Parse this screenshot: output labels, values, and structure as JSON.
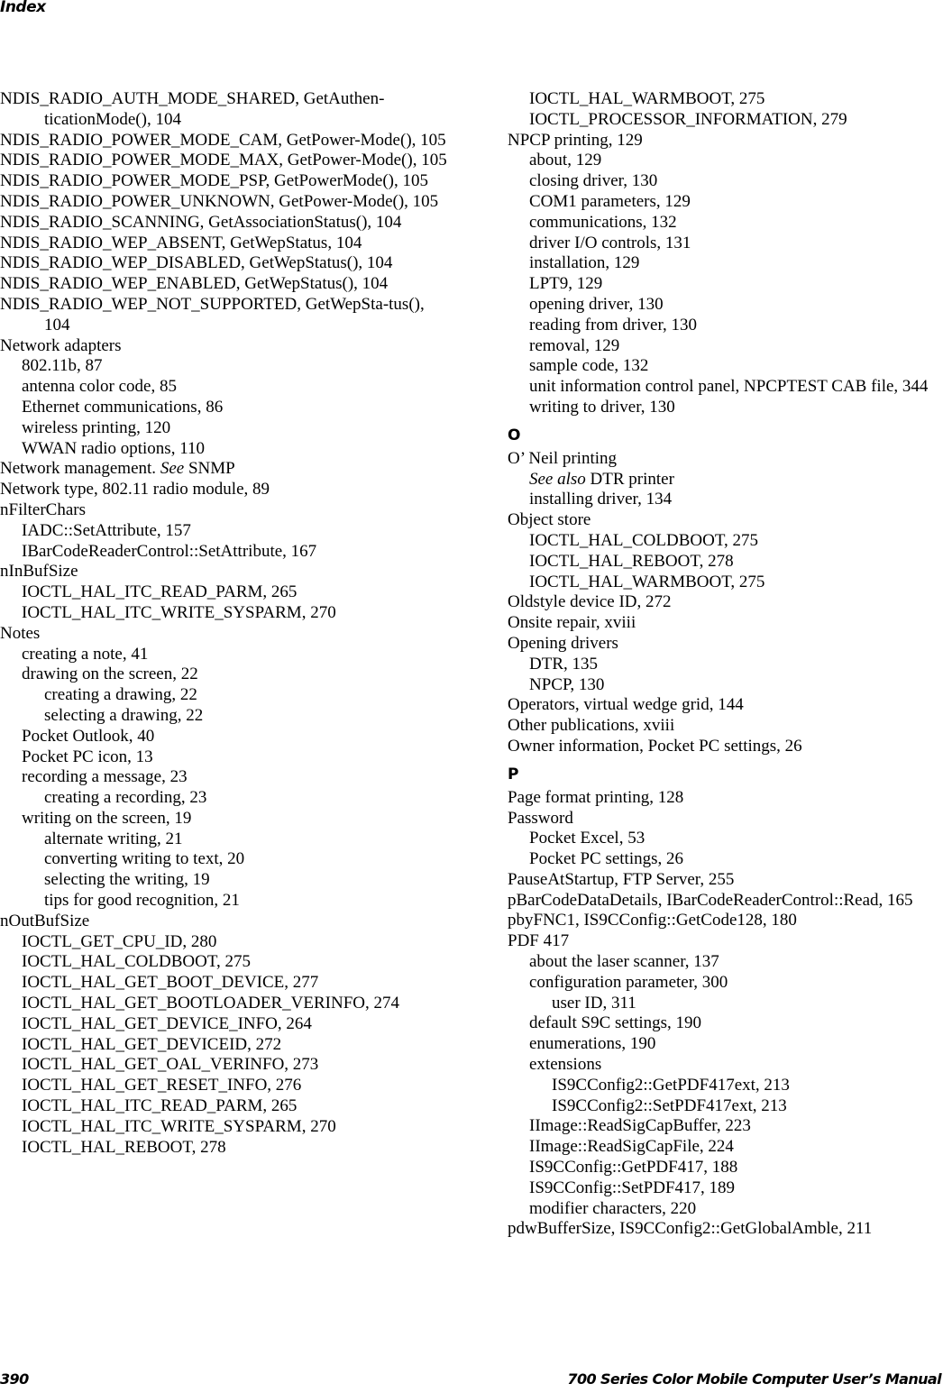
{
  "header": {
    "running_head": "Index"
  },
  "footer": {
    "page_number": "390",
    "manual_title": "700 Series Color Mobile Computer User’s Manual"
  },
  "left_column": [
    {
      "level": 0,
      "text": "NDIS_RADIO_AUTH_MODE_SHARED, GetAuthen-ticationMode(), 104"
    },
    {
      "level": 0,
      "text": "NDIS_RADIO_POWER_MODE_CAM, GetPower-Mode(), 105"
    },
    {
      "level": 0,
      "text": "NDIS_RADIO_POWER_MODE_MAX, GetPower-Mode(), 105"
    },
    {
      "level": 0,
      "text": "NDIS_RADIO_POWER_MODE_PSP, GetPowerMode(), 105"
    },
    {
      "level": 0,
      "text": "NDIS_RADIO_POWER_UNKNOWN, GetPower-Mode(), 105"
    },
    {
      "level": 0,
      "text": "NDIS_RADIO_SCANNING, GetAssociationStatus(), 104"
    },
    {
      "level": 0,
      "text": "NDIS_RADIO_WEP_ABSENT, GetWepStatus, 104"
    },
    {
      "level": 0,
      "text": "NDIS_RADIO_WEP_DISABLED, GetWepStatus(), 104"
    },
    {
      "level": 0,
      "text": "NDIS_RADIO_WEP_ENABLED, GetWepStatus(), 104"
    },
    {
      "level": 0,
      "text": "NDIS_RADIO_WEP_NOT_SUPPORTED, GetWepSta-tus(), 104"
    },
    {
      "level": 0,
      "text": "Network adapters"
    },
    {
      "level": 1,
      "text": "802.11b, 87"
    },
    {
      "level": 1,
      "text": "antenna color code, 85"
    },
    {
      "level": 1,
      "text": "Ethernet communications, 86"
    },
    {
      "level": 1,
      "text": "wireless printing, 120"
    },
    {
      "level": 1,
      "text": "WWAN radio options, 110"
    },
    {
      "level": 0,
      "text": "Network management. ",
      "see": "See",
      "after": " SNMP"
    },
    {
      "level": 0,
      "text": "Network type, 802.11 radio module, 89"
    },
    {
      "level": 0,
      "text": "nFilterChars"
    },
    {
      "level": 1,
      "text": "IADC::SetAttribute, 157"
    },
    {
      "level": 1,
      "text": "IBarCodeReaderControl::SetAttribute, 167"
    },
    {
      "level": 0,
      "text": "nInBufSize"
    },
    {
      "level": 1,
      "text": "IOCTL_HAL_ITC_READ_PARM, 265"
    },
    {
      "level": 1,
      "text": "IOCTL_HAL_ITC_WRITE_SYSPARM, 270"
    },
    {
      "level": 0,
      "text": "Notes"
    },
    {
      "level": 1,
      "text": "creating a note, 41"
    },
    {
      "level": 1,
      "text": "drawing on the screen, 22"
    },
    {
      "level": 2,
      "text": "creating a drawing, 22"
    },
    {
      "level": 2,
      "text": "selecting a drawing, 22"
    },
    {
      "level": 1,
      "text": "Pocket Outlook, 40"
    },
    {
      "level": 1,
      "text": "Pocket PC icon, 13"
    },
    {
      "level": 1,
      "text": "recording a message, 23"
    },
    {
      "level": 2,
      "text": "creating a recording, 23"
    },
    {
      "level": 1,
      "text": "writing on the screen, 19"
    },
    {
      "level": 2,
      "text": "alternate writing, 21"
    },
    {
      "level": 2,
      "text": "converting writing to text, 20"
    },
    {
      "level": 2,
      "text": "selecting the writing, 19"
    },
    {
      "level": 2,
      "text": "tips for good recognition, 21"
    },
    {
      "level": 0,
      "text": "nOutBufSize"
    },
    {
      "level": 1,
      "text": "IOCTL_GET_CPU_ID, 280"
    },
    {
      "level": 1,
      "text": "IOCTL_HAL_COLDBOOT, 275"
    },
    {
      "level": 1,
      "text": "IOCTL_HAL_GET_BOOT_DEVICE, 277"
    },
    {
      "level": 1,
      "text": "IOCTL_HAL_GET_BOOTLOADER_VERINFO, 274"
    },
    {
      "level": 1,
      "text": "IOCTL_HAL_GET_DEVICE_INFO, 264"
    },
    {
      "level": 1,
      "text": "IOCTL_HAL_GET_DEVICEID, 272"
    },
    {
      "level": 1,
      "text": "IOCTL_HAL_GET_OAL_VERINFO, 273"
    },
    {
      "level": 1,
      "text": "IOCTL_HAL_GET_RESET_INFO, 276"
    },
    {
      "level": 1,
      "text": "IOCTL_HAL_ITC_READ_PARM, 265"
    },
    {
      "level": 1,
      "text": "IOCTL_HAL_ITC_WRITE_SYSPARM, 270"
    },
    {
      "level": 1,
      "text": "IOCTL_HAL_REBOOT, 278"
    }
  ],
  "right_column": [
    {
      "level": 1,
      "text": "IOCTL_HAL_WARMBOOT, 275"
    },
    {
      "level": 1,
      "text": "IOCTL_PROCESSOR_INFORMATION, 279"
    },
    {
      "level": 0,
      "text": "NPCP printing, 129"
    },
    {
      "level": 1,
      "text": "about, 129"
    },
    {
      "level": 1,
      "text": "closing driver, 130"
    },
    {
      "level": 1,
      "text": "COM1 parameters, 129"
    },
    {
      "level": 1,
      "text": "communications, 132"
    },
    {
      "level": 1,
      "text": "driver I/O controls, 131"
    },
    {
      "level": 1,
      "text": "installation, 129"
    },
    {
      "level": 1,
      "text": "LPT9, 129"
    },
    {
      "level": 1,
      "text": "opening driver, 130"
    },
    {
      "level": 1,
      "text": "reading from driver, 130"
    },
    {
      "level": 1,
      "text": "removal, 129"
    },
    {
      "level": 1,
      "text": "sample code, 132"
    },
    {
      "level": 1,
      "text": "unit information control panel, NPCPTEST CAB file, 344"
    },
    {
      "level": 1,
      "text": "writing to driver, 130"
    },
    {
      "letter": "O"
    },
    {
      "level": 0,
      "text": "O’ Neil printing"
    },
    {
      "level": 1,
      "text": "",
      "see": "See also",
      "after": " DTR printer"
    },
    {
      "level": 1,
      "text": "installing driver, 134"
    },
    {
      "level": 0,
      "text": "Object store"
    },
    {
      "level": 1,
      "text": "IOCTL_HAL_COLDBOOT, 275"
    },
    {
      "level": 1,
      "text": "IOCTL_HAL_REBOOT, 278"
    },
    {
      "level": 1,
      "text": "IOCTL_HAL_WARMBOOT, 275"
    },
    {
      "level": 0,
      "text": "Oldstyle device ID, 272"
    },
    {
      "level": 0,
      "text": "Onsite repair, xviii"
    },
    {
      "level": 0,
      "text": "Opening drivers"
    },
    {
      "level": 1,
      "text": "DTR, 135"
    },
    {
      "level": 1,
      "text": "NPCP, 130"
    },
    {
      "level": 0,
      "text": "Operators, virtual wedge grid, 144"
    },
    {
      "level": 0,
      "text": "Other publications, xviii"
    },
    {
      "level": 0,
      "text": "Owner information, Pocket PC settings, 26"
    },
    {
      "letter": "P"
    },
    {
      "level": 0,
      "text": "Page format printing, 128"
    },
    {
      "level": 0,
      "text": "Password"
    },
    {
      "level": 1,
      "text": "Pocket Excel, 53"
    },
    {
      "level": 1,
      "text": "Pocket PC settings, 26"
    },
    {
      "level": 0,
      "text": "PauseAtStartup, FTP Server, 255"
    },
    {
      "level": 0,
      "text": "pBarCodeDataDetails, IBarCodeReaderControl::Read, 165"
    },
    {
      "level": 0,
      "text": "pbyFNC1, IS9CConfig::GetCode128, 180"
    },
    {
      "level": 0,
      "text": "PDF 417"
    },
    {
      "level": 1,
      "text": "about the laser scanner, 137"
    },
    {
      "level": 1,
      "text": "configuration parameter, 300"
    },
    {
      "level": 2,
      "text": "user ID, 311"
    },
    {
      "level": 1,
      "text": "default S9C settings, 190"
    },
    {
      "level": 1,
      "text": "enumerations, 190"
    },
    {
      "level": 1,
      "text": "extensions"
    },
    {
      "level": 2,
      "text": "IS9CConfig2::GetPDF417ext, 213"
    },
    {
      "level": 2,
      "text": "IS9CConfig2::SetPDF417ext, 213"
    },
    {
      "level": 1,
      "text": "IImage::ReadSigCapBuffer, 223"
    },
    {
      "level": 1,
      "text": "IImage::ReadSigCapFile, 224"
    },
    {
      "level": 1,
      "text": "IS9CConfig::GetPDF417, 188"
    },
    {
      "level": 1,
      "text": "IS9CConfig::SetPDF417, 189"
    },
    {
      "level": 1,
      "text": "modifier characters, 220"
    },
    {
      "level": 0,
      "text": "pdwBufferSize, IS9CConfig2::GetGlobalAmble, 211"
    }
  ]
}
